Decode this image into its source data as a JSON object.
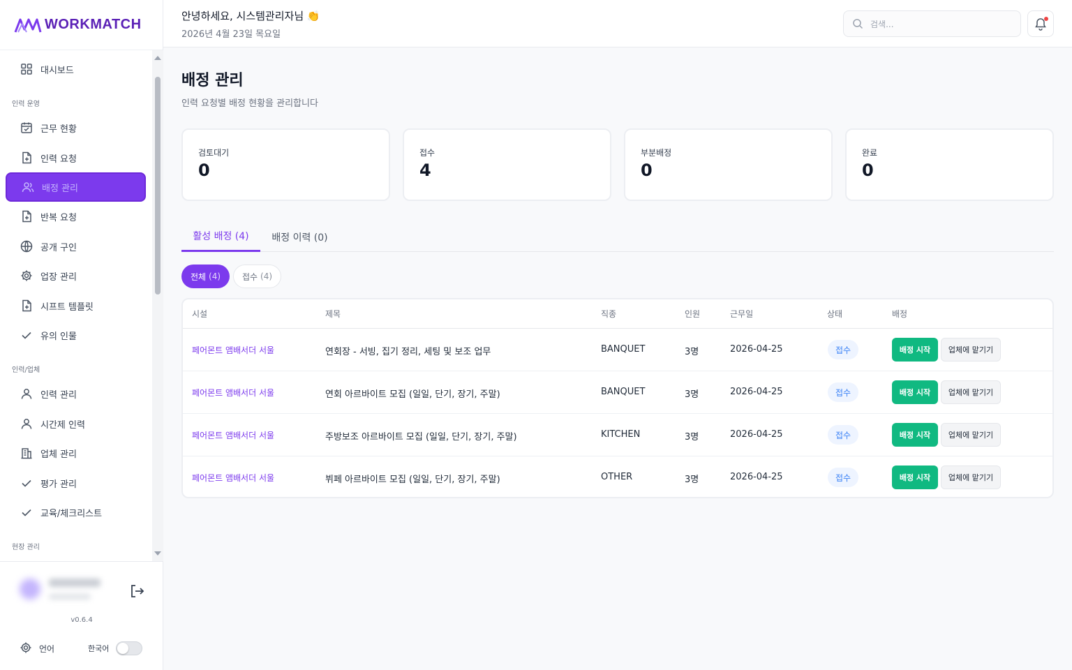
{
  "brand": {
    "name": "WORKMATCH",
    "color": "#5b21b6",
    "accent": "#7c3aed"
  },
  "sidebar": {
    "items": [
      {
        "label": "대시보드",
        "icon": "grid-icon"
      },
      {
        "label": "근무 현황",
        "icon": "calendar-check-icon"
      },
      {
        "label": "인력 요청",
        "icon": "file-plus-icon"
      },
      {
        "label": "배정 관리",
        "icon": "users-icon",
        "active": true
      },
      {
        "label": "반복 요청",
        "icon": "file-plus-icon"
      },
      {
        "label": "공개 구인",
        "icon": "globe-icon"
      },
      {
        "label": "업장 관리",
        "icon": "gear-icon"
      },
      {
        "label": "시프트 템플릿",
        "icon": "file-plus-icon"
      },
      {
        "label": "유의 인물",
        "icon": "check-icon"
      },
      {
        "label": "인력 관리",
        "icon": "user-icon"
      },
      {
        "label": "시간제 인력",
        "icon": "user-icon"
      },
      {
        "label": "업체 관리",
        "icon": "building-icon"
      },
      {
        "label": "평가 관리",
        "icon": "check-icon"
      },
      {
        "label": "교육/체크리스트",
        "icon": "check-icon"
      }
    ],
    "sections": [
      "인력 운영",
      "인력/업체",
      "현장 관리"
    ],
    "version": "v0.6.4",
    "language_label": "언어",
    "language_value": "한국어"
  },
  "header": {
    "greeting": "안녕하세요, 시스템관리자님 👏",
    "date": "2026년 4월 23일 목요일",
    "search_placeholder": "검색..."
  },
  "page": {
    "title": "배정 관리",
    "subtitle": "인력 요청별 배정 현황을 관리합니다"
  },
  "stats": [
    {
      "label": "검토대기",
      "value": "0"
    },
    {
      "label": "접수",
      "value": "4"
    },
    {
      "label": "부분배정",
      "value": "0"
    },
    {
      "label": "완료",
      "value": "0"
    }
  ],
  "tabs": [
    "활성 배정 (4)",
    "배정 이력 (0)"
  ],
  "filters": [
    {
      "label": "전체",
      "count": "(4)"
    },
    {
      "label": "접수",
      "count": "(4)"
    }
  ],
  "table": {
    "columns": [
      "시설",
      "제목",
      "직종",
      "인원",
      "근무일",
      "상태",
      "배정"
    ],
    "rows": [
      {
        "facility": "페어몬트 앰배서더 서울",
        "title": "연회장 - 서빙, 집기 정리, 세팅 및 보조 업무",
        "job": "BANQUET",
        "count": "3명",
        "date": "2026-04-25",
        "status": "접수"
      },
      {
        "facility": "페어몬트 앰배서더 서울",
        "title": "연회 아르바이트 모집 (일일, 단기, 장기, 주말)",
        "job": "BANQUET",
        "count": "3명",
        "date": "2026-04-25",
        "status": "접수"
      },
      {
        "facility": "페어몬트 앰배서더 서울",
        "title": "주방보조 아르바이트 모집 (일일, 단기, 장기, 주말)",
        "job": "KITCHEN",
        "count": "3명",
        "date": "2026-04-25",
        "status": "접수"
      },
      {
        "facility": "페어몬트 앰배서더 서울",
        "title": "뷔페 아르바이트 모집 (일일, 단기, 장기, 주말)",
        "job": "OTHER",
        "count": "3명",
        "date": "2026-04-25",
        "status": "접수"
      }
    ],
    "start_label": "배정 시작",
    "delegate_label": "업체에 맡기기"
  }
}
